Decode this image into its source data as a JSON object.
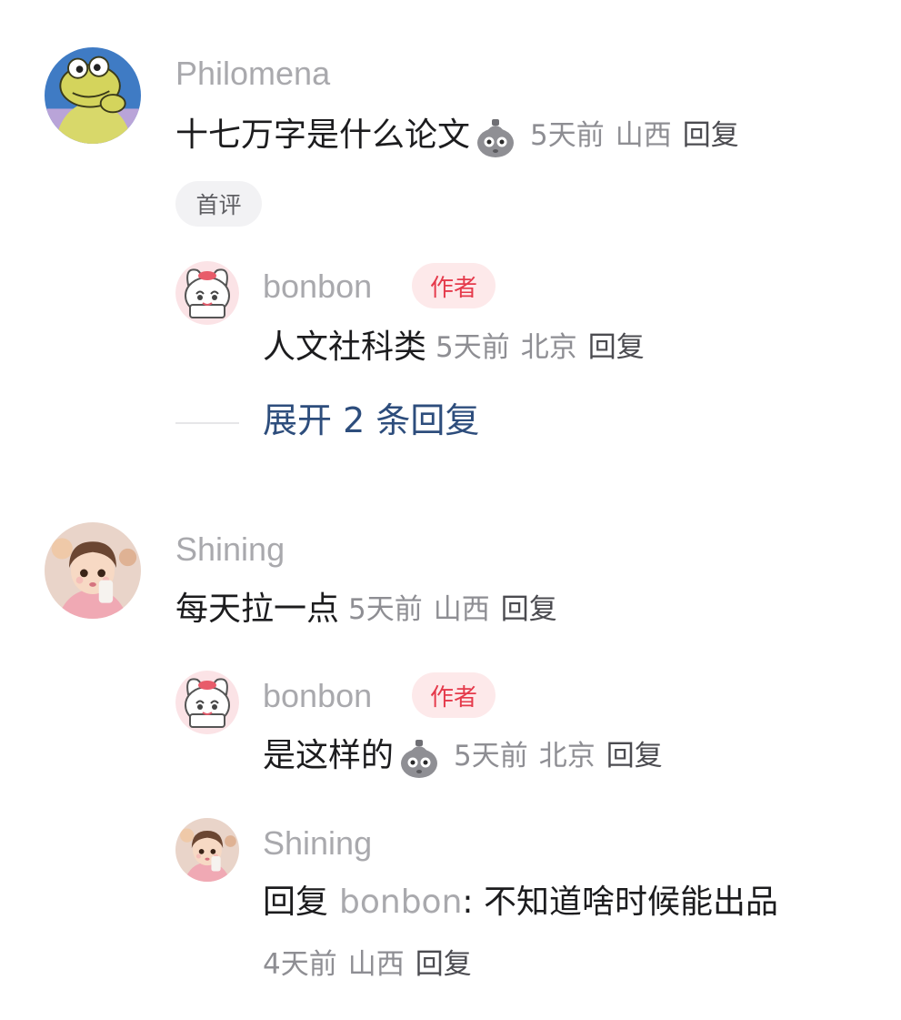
{
  "comments": [
    {
      "username": "Philomena",
      "text": "十七万字是什么论文",
      "time": "5天前",
      "location": "山西",
      "reply_label": "回复",
      "badge": "首评",
      "avatar_icon": "frog-cartoon-avatar",
      "replies": [
        {
          "username": "bonbon",
          "author_badge": "作者",
          "text": "人文社科类",
          "time": "5天前",
          "location": "北京",
          "reply_label": "回复",
          "avatar_icon": "cartoon-bunny-avatar"
        }
      ],
      "expand_label": "展开 2 条回复"
    },
    {
      "username": "Shining",
      "text": "每天拉一点",
      "time": "5天前",
      "location": "山西",
      "reply_label": "回复",
      "avatar_icon": "little-girl-photo-avatar",
      "replies": [
        {
          "username": "bonbon",
          "author_badge": "作者",
          "text": "是这样的",
          "time": "5天前",
          "location": "北京",
          "reply_label": "回复",
          "avatar_icon": "cartoon-bunny-avatar"
        },
        {
          "username": "Shining",
          "reply_prefix": "回复",
          "reply_to": "bonbon",
          "text": ": 不知道啥时候能出品",
          "time": "4天前",
          "location": "山西",
          "reply_label": "回复",
          "avatar_icon": "little-girl-photo-avatar"
        }
      ]
    }
  ],
  "colors": {
    "username": "#a9a9ad",
    "content": "#1c1c1e",
    "meta": "#8e8e93",
    "author_badge_bg": "#fde9ea",
    "author_badge_text": "#e53a4b",
    "expand_link": "#2d4d7c"
  },
  "emoji_icon": "grey-pouch-emoji"
}
